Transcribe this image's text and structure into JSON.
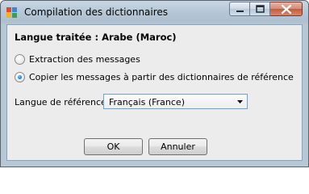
{
  "window": {
    "title": "Compilation des dictionnaires"
  },
  "dialog": {
    "language_heading": "Langue traitée : Arabe (Maroc)",
    "options": [
      {
        "label": "Extraction des messages",
        "checked": false
      },
      {
        "label": "Copier les messages à partir des dictionnaires de référence",
        "checked": true
      }
    ],
    "reference_language": {
      "label": "Langue de référence:",
      "value": "Français (France)"
    },
    "buttons": {
      "ok": "OK",
      "cancel": "Annuler"
    }
  },
  "icons": {
    "app": "dictionary-app-icon",
    "minimize": "minimize-icon",
    "maximize": "maximize-icon",
    "close": "close-icon",
    "dropdown": "chevron-down-icon"
  },
  "colors": {
    "close_button": "#c55a3e",
    "radio_selected": "#1a7fd6",
    "dialog_background": "#ececec"
  }
}
